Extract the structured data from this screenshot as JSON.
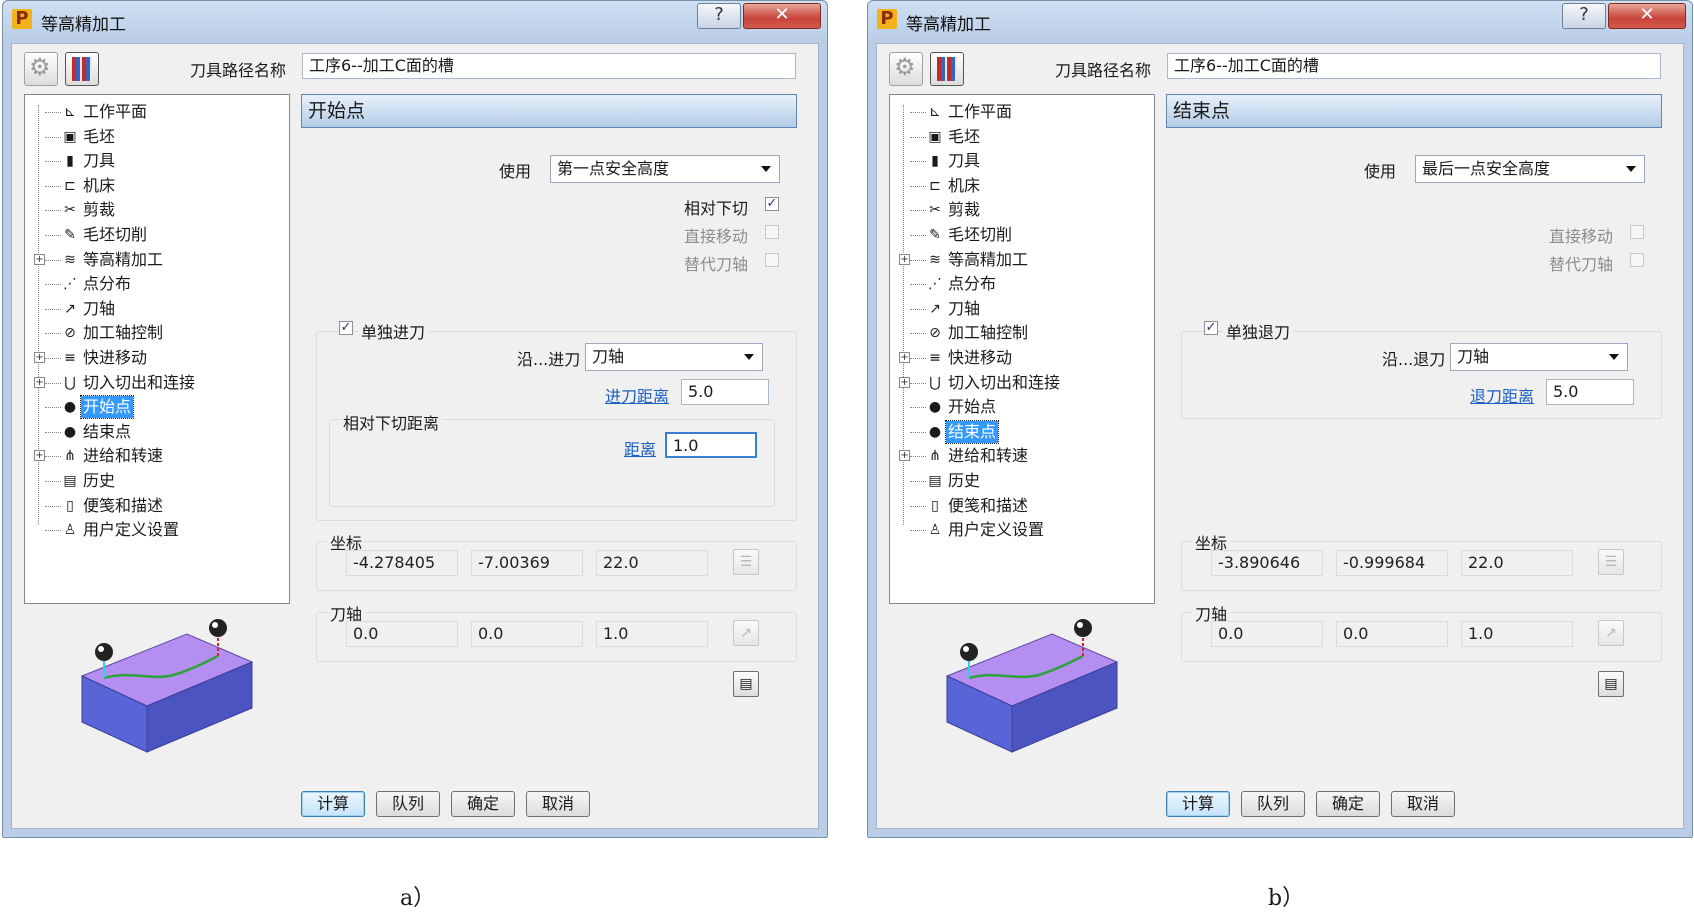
{
  "dialogs": [
    {
      "title": "等高精加工",
      "help_glyph": "?",
      "close_glyph": "✕",
      "toolpath_label": "刀具路径名称",
      "toolpath_name": "工序6--加工C面的槽",
      "tree": [
        {
          "label": "工作平面",
          "icon": "workplane-icon",
          "glyph": "⊾",
          "expand": ""
        },
        {
          "label": "毛坯",
          "icon": "block-icon",
          "glyph": "▣",
          "expand": ""
        },
        {
          "label": "刀具",
          "icon": "tool-icon",
          "glyph": "▮",
          "expand": ""
        },
        {
          "label": "机床",
          "icon": "machine-icon",
          "glyph": "⊏",
          "expand": ""
        },
        {
          "label": "剪裁",
          "icon": "limit-icon",
          "glyph": "✂",
          "expand": ""
        },
        {
          "label": "毛坯切削",
          "icon": "stock-cut-icon",
          "glyph": "✎",
          "expand": ""
        },
        {
          "label": "等高精加工",
          "icon": "layers-icon",
          "glyph": "≋",
          "expand": "+"
        },
        {
          "label": "点分布",
          "icon": "point-distribution-icon",
          "glyph": "⋰",
          "expand": ""
        },
        {
          "label": "刀轴",
          "icon": "tool-axis-icon",
          "glyph": "↗",
          "expand": ""
        },
        {
          "label": "加工轴控制",
          "icon": "axis-control-icon",
          "glyph": "⊘",
          "expand": ""
        },
        {
          "label": "快进移动",
          "icon": "rapid-move-icon",
          "glyph": "≡",
          "expand": "+"
        },
        {
          "label": "切入切出和连接",
          "icon": "leads-links-icon",
          "glyph": "⋃",
          "expand": "+"
        },
        {
          "label": "开始点",
          "icon": "start-point-icon",
          "glyph": "●",
          "expand": "",
          "selected": true
        },
        {
          "label": "结束点",
          "icon": "end-point-icon",
          "glyph": "●",
          "expand": ""
        },
        {
          "label": "进给和转速",
          "icon": "feeds-speeds-icon",
          "glyph": "⋔",
          "expand": "+"
        },
        {
          "label": "历史",
          "icon": "history-icon",
          "glyph": "▤",
          "expand": ""
        },
        {
          "label": "便笺和描述",
          "icon": "notes-icon",
          "glyph": "▯",
          "expand": ""
        },
        {
          "label": "用户定义设置",
          "icon": "user-settings-icon",
          "glyph": "♙",
          "expand": ""
        }
      ],
      "header": "开始点",
      "use_label": "使用",
      "use_value": "第一点安全高度",
      "checks": [
        {
          "label": "相对下切",
          "checked": true,
          "disabled": false
        },
        {
          "label": "直接移动",
          "checked": false,
          "disabled": true
        },
        {
          "label": "替代刀轴",
          "checked": false,
          "disabled": true
        }
      ],
      "move_check_label": "单独进刀",
      "move_along_label": "沿...进刀",
      "move_along_value": "刀轴",
      "move_distance_label": "进刀距离",
      "move_distance_value": "5.0",
      "sub_group_label": "相对下切距离",
      "sub_distance_label": "距离",
      "sub_distance_value": "1.0",
      "coord_label": "坐标",
      "coords": [
        "-4.278405",
        "-7.00369",
        "22.0"
      ],
      "axis_label": "刀轴",
      "axis": [
        "0.0",
        "0.0",
        "1.0"
      ],
      "buttons": {
        "calc": "计算",
        "queue": "队列",
        "ok": "确定",
        "cancel": "取消"
      },
      "caption": "a）"
    },
    {
      "title": "等高精加工",
      "help_glyph": "?",
      "close_glyph": "✕",
      "toolpath_label": "刀具路径名称",
      "toolpath_name": "工序6--加工C面的槽",
      "tree": [
        {
          "label": "工作平面",
          "icon": "workplane-icon",
          "glyph": "⊾",
          "expand": ""
        },
        {
          "label": "毛坯",
          "icon": "block-icon",
          "glyph": "▣",
          "expand": ""
        },
        {
          "label": "刀具",
          "icon": "tool-icon",
          "glyph": "▮",
          "expand": ""
        },
        {
          "label": "机床",
          "icon": "machine-icon",
          "glyph": "⊏",
          "expand": ""
        },
        {
          "label": "剪裁",
          "icon": "limit-icon",
          "glyph": "✂",
          "expand": ""
        },
        {
          "label": "毛坯切削",
          "icon": "stock-cut-icon",
          "glyph": "✎",
          "expand": ""
        },
        {
          "label": "等高精加工",
          "icon": "layers-icon",
          "glyph": "≋",
          "expand": "+"
        },
        {
          "label": "点分布",
          "icon": "point-distribution-icon",
          "glyph": "⋰",
          "expand": ""
        },
        {
          "label": "刀轴",
          "icon": "tool-axis-icon",
          "glyph": "↗",
          "expand": ""
        },
        {
          "label": "加工轴控制",
          "icon": "axis-control-icon",
          "glyph": "⊘",
          "expand": ""
        },
        {
          "label": "快进移动",
          "icon": "rapid-move-icon",
          "glyph": "≡",
          "expand": "+"
        },
        {
          "label": "切入切出和连接",
          "icon": "leads-links-icon",
          "glyph": "⋃",
          "expand": "+"
        },
        {
          "label": "开始点",
          "icon": "start-point-icon",
          "glyph": "●",
          "expand": ""
        },
        {
          "label": "结束点",
          "icon": "end-point-icon",
          "glyph": "●",
          "expand": "",
          "selected": true
        },
        {
          "label": "进给和转速",
          "icon": "feeds-speeds-icon",
          "glyph": "⋔",
          "expand": "+"
        },
        {
          "label": "历史",
          "icon": "history-icon",
          "glyph": "▤",
          "expand": ""
        },
        {
          "label": "便笺和描述",
          "icon": "notes-icon",
          "glyph": "▯",
          "expand": ""
        },
        {
          "label": "用户定义设置",
          "icon": "user-settings-icon",
          "glyph": "♙",
          "expand": ""
        }
      ],
      "header": "结束点",
      "use_label": "使用",
      "use_value": "最后一点安全高度",
      "checks": [
        {
          "label": "直接移动",
          "checked": false,
          "disabled": true
        },
        {
          "label": "替代刀轴",
          "checked": false,
          "disabled": true
        }
      ],
      "move_check_label": "单独退刀",
      "move_along_label": "沿...退刀",
      "move_along_value": "刀轴",
      "move_distance_label": "退刀距离",
      "move_distance_value": "5.0",
      "coord_label": "坐标",
      "coords": [
        "-3.890646",
        "-0.999684",
        "22.0"
      ],
      "axis_label": "刀轴",
      "axis": [
        "0.0",
        "0.0",
        "1.0"
      ],
      "buttons": {
        "calc": "计算",
        "queue": "队列",
        "ok": "确定",
        "cancel": "取消"
      },
      "caption": "b）"
    }
  ],
  "colors": {
    "selection": "#3399ff",
    "link": "#1a5fc4",
    "block_top": "#b48ef0",
    "block_front": "#5964d6",
    "toolpath": "#2ea33a"
  }
}
